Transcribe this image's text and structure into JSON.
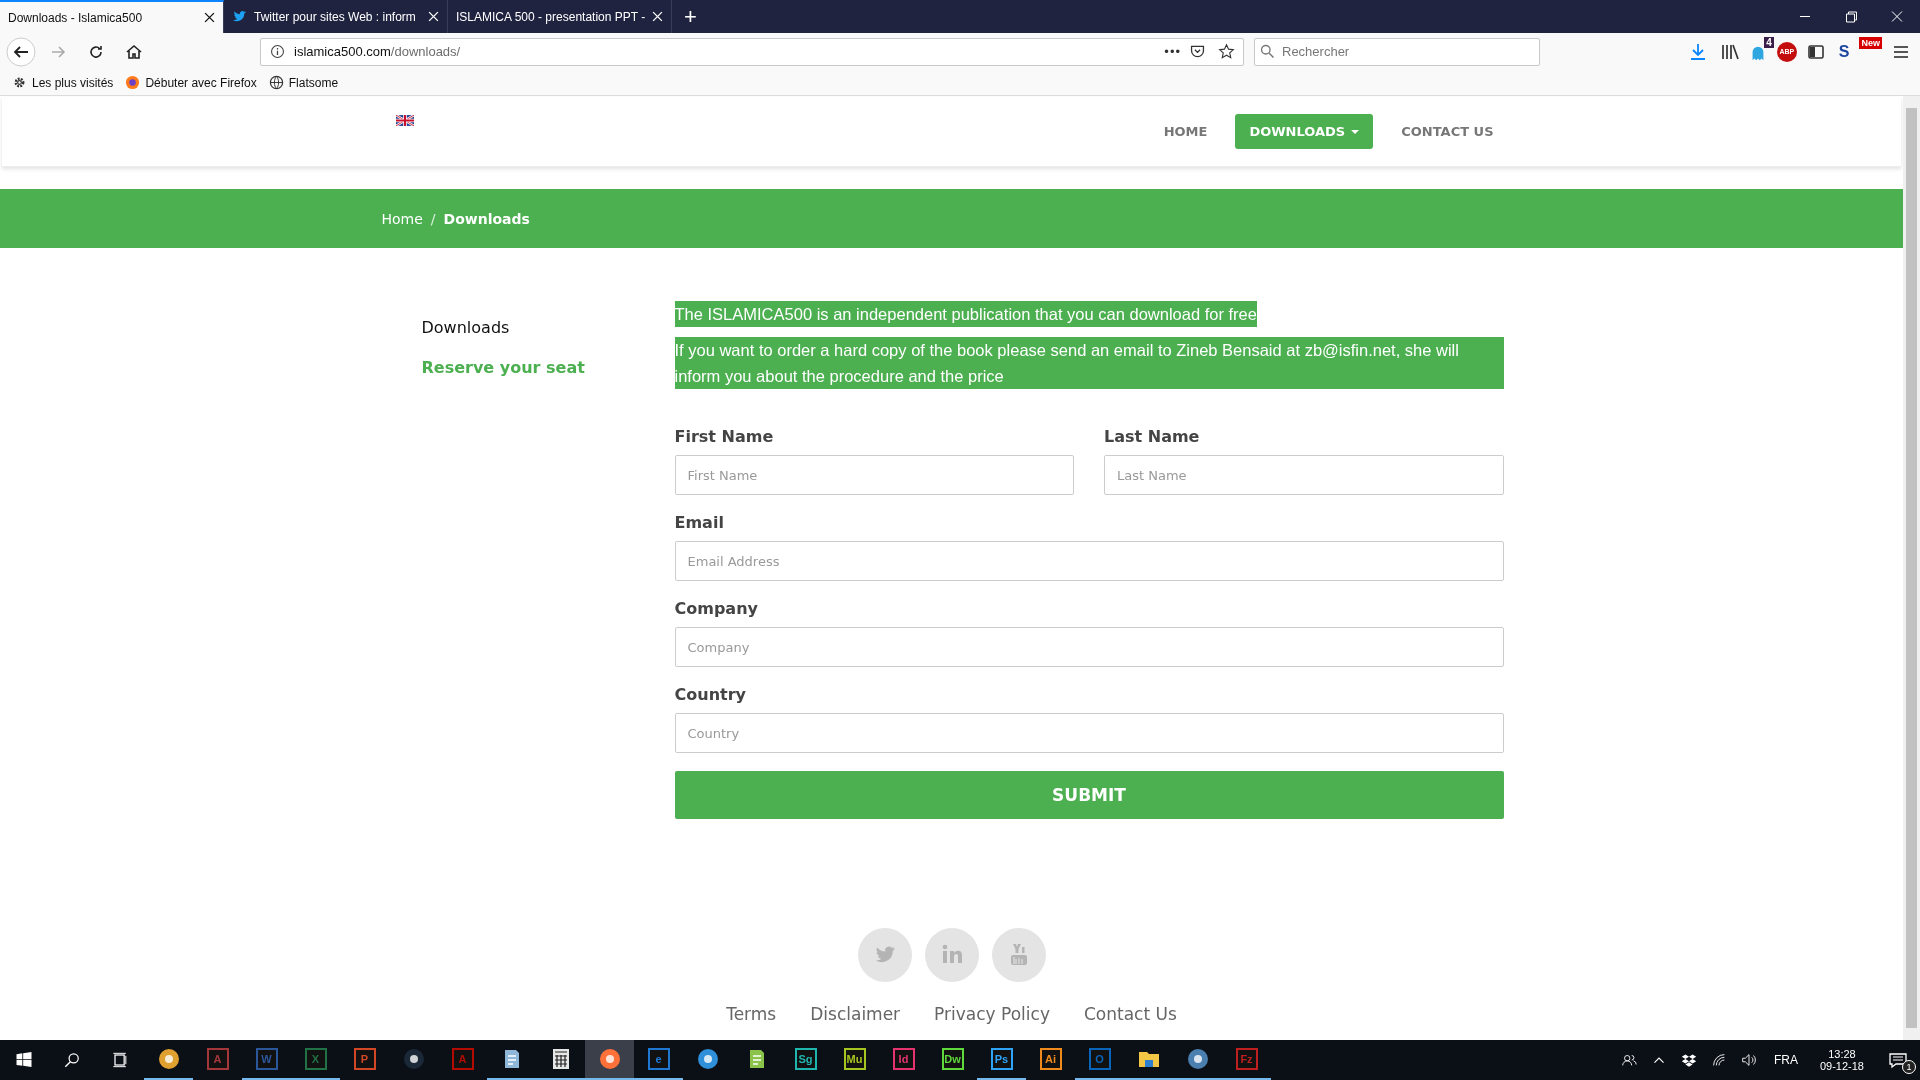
{
  "browser": {
    "tabs": [
      {
        "title": "Downloads - Islamica500",
        "selected": true,
        "kind": "plain"
      },
      {
        "title": "Twitter pour sites Web : inform",
        "selected": false,
        "kind": "bird"
      },
      {
        "title": "ISLAMICA 500 - presentation PPT -",
        "selected": false,
        "kind": "plain"
      }
    ],
    "new_tab": "+",
    "url_host": "islamica500.com",
    "url_path": "/downloads/",
    "url_more": "•••",
    "search": {
      "placeholder": "Rechercher"
    },
    "extensions": [
      {
        "kind": "download"
      },
      {
        "kind": "library"
      },
      {
        "kind": "ghost",
        "badge": "4"
      },
      {
        "kind": "abp",
        "label": "ABP"
      },
      {
        "kind": "sidebar"
      },
      {
        "kind": "s",
        "label": "S"
      },
      {
        "kind": "new",
        "label": "New"
      }
    ],
    "bookmarks": [
      {
        "label": "Les plus visités",
        "kind": "gear"
      },
      {
        "label": "Débuter avec Firefox",
        "kind": "fox"
      },
      {
        "label": "Flatsome",
        "kind": "globe"
      }
    ]
  },
  "site": {
    "nav": [
      {
        "label": "HOME",
        "selected": false,
        "dropdown": false
      },
      {
        "label": "DOWNLOADS",
        "selected": true,
        "dropdown": true
      },
      {
        "label": "CONTACT US",
        "selected": false,
        "dropdown": false
      }
    ],
    "breadcrumb_separator": "/",
    "breadcrumb": [
      {
        "label": "Home",
        "current": false
      },
      {
        "label": "Downloads",
        "current": true
      }
    ],
    "sidebar": [
      {
        "label": "Downloads",
        "selected": false
      },
      {
        "label": "Reserve your seat",
        "selected": true
      }
    ],
    "intro": [
      "The ISLAMICA500 is an independent publication that you can download for free",
      "If you want to order a hard copy of the book please send an email to Zineb Bensaid at zb@isfin.net, she will inform you about the procedure and the price"
    ],
    "form": {
      "rows": [
        [
          {
            "label": "First Name",
            "placeholder": "First Name"
          },
          {
            "label": "Last Name",
            "placeholder": "Last Name"
          }
        ],
        [
          {
            "label": "Email",
            "placeholder": "Email Address"
          }
        ],
        [
          {
            "label": "Company",
            "placeholder": "Company"
          }
        ],
        [
          {
            "label": "Country",
            "placeholder": "Country"
          }
        ]
      ],
      "submit": "SUBMIT"
    },
    "social": [
      {
        "kind": "twitter"
      },
      {
        "kind": "linkedin"
      },
      {
        "kind": "youtube"
      }
    ],
    "footer_links": [
      "Terms",
      "Disclaimer",
      "Privacy Policy",
      "Contact Us"
    ]
  },
  "taskbar": {
    "apps": [
      {
        "kind": "round",
        "color": "#e0a030",
        "running": true,
        "selected": false
      },
      {
        "kind": "letter",
        "label": "A",
        "color": "#a4373a",
        "running": false,
        "selected": false
      },
      {
        "kind": "letter",
        "label": "W",
        "color": "#2b579a",
        "running": true,
        "selected": false
      },
      {
        "kind": "letter",
        "label": "X",
        "color": "#217346",
        "running": true,
        "selected": false
      },
      {
        "kind": "letter",
        "label": "P",
        "color": "#d24726",
        "running": false,
        "selected": false
      },
      {
        "kind": "round",
        "color": "#1b2838",
        "running": false,
        "selected": false
      },
      {
        "kind": "letter",
        "label": "A",
        "color": "#b30b00",
        "running": false,
        "selected": false
      },
      {
        "kind": "doc",
        "color": "#8fb8d8",
        "running": true,
        "selected": false
      },
      {
        "kind": "calculator",
        "color": "#e6e6e6",
        "running": true,
        "selected": false
      },
      {
        "kind": "round",
        "color": "#ff7139",
        "running": true,
        "selected": true
      },
      {
        "kind": "letter",
        "label": "e",
        "color": "#1e78d2",
        "running": true,
        "selected": false
      },
      {
        "kind": "round",
        "color": "#2f8fd8",
        "running": false,
        "selected": false
      },
      {
        "kind": "doc",
        "color": "#8bc34a",
        "running": false,
        "selected": false
      },
      {
        "kind": "letter",
        "label": "Sg",
        "color": "#1fb6b0",
        "running": false,
        "selected": false
      },
      {
        "kind": "letter",
        "label": "Mu",
        "color": "#a7c520",
        "running": false,
        "selected": false
      },
      {
        "kind": "letter",
        "label": "Id",
        "color": "#e6336f",
        "running": false,
        "selected": false
      },
      {
        "kind": "letter",
        "label": "Dw",
        "color": "#5ed83b",
        "running": false,
        "selected": false
      },
      {
        "kind": "letter",
        "label": "Ps",
        "color": "#2fa3f7",
        "running": true,
        "selected": false
      },
      {
        "kind": "letter",
        "label": "Ai",
        "color": "#f08a1d",
        "running": false,
        "selected": false
      },
      {
        "kind": "letter",
        "label": "O",
        "color": "#0a64b8",
        "running": true,
        "selected": false
      },
      {
        "kind": "folder",
        "color": "#f3c645",
        "running": true,
        "selected": false
      },
      {
        "kind": "round",
        "color": "#4a7fb0",
        "running": true,
        "selected": false
      },
      {
        "kind": "letter",
        "label": "Fz",
        "color": "#bf1f1f",
        "running": true,
        "selected": false
      }
    ],
    "language": "FRA",
    "time": "13:28",
    "date": "09-12-18",
    "notifications": "1"
  }
}
